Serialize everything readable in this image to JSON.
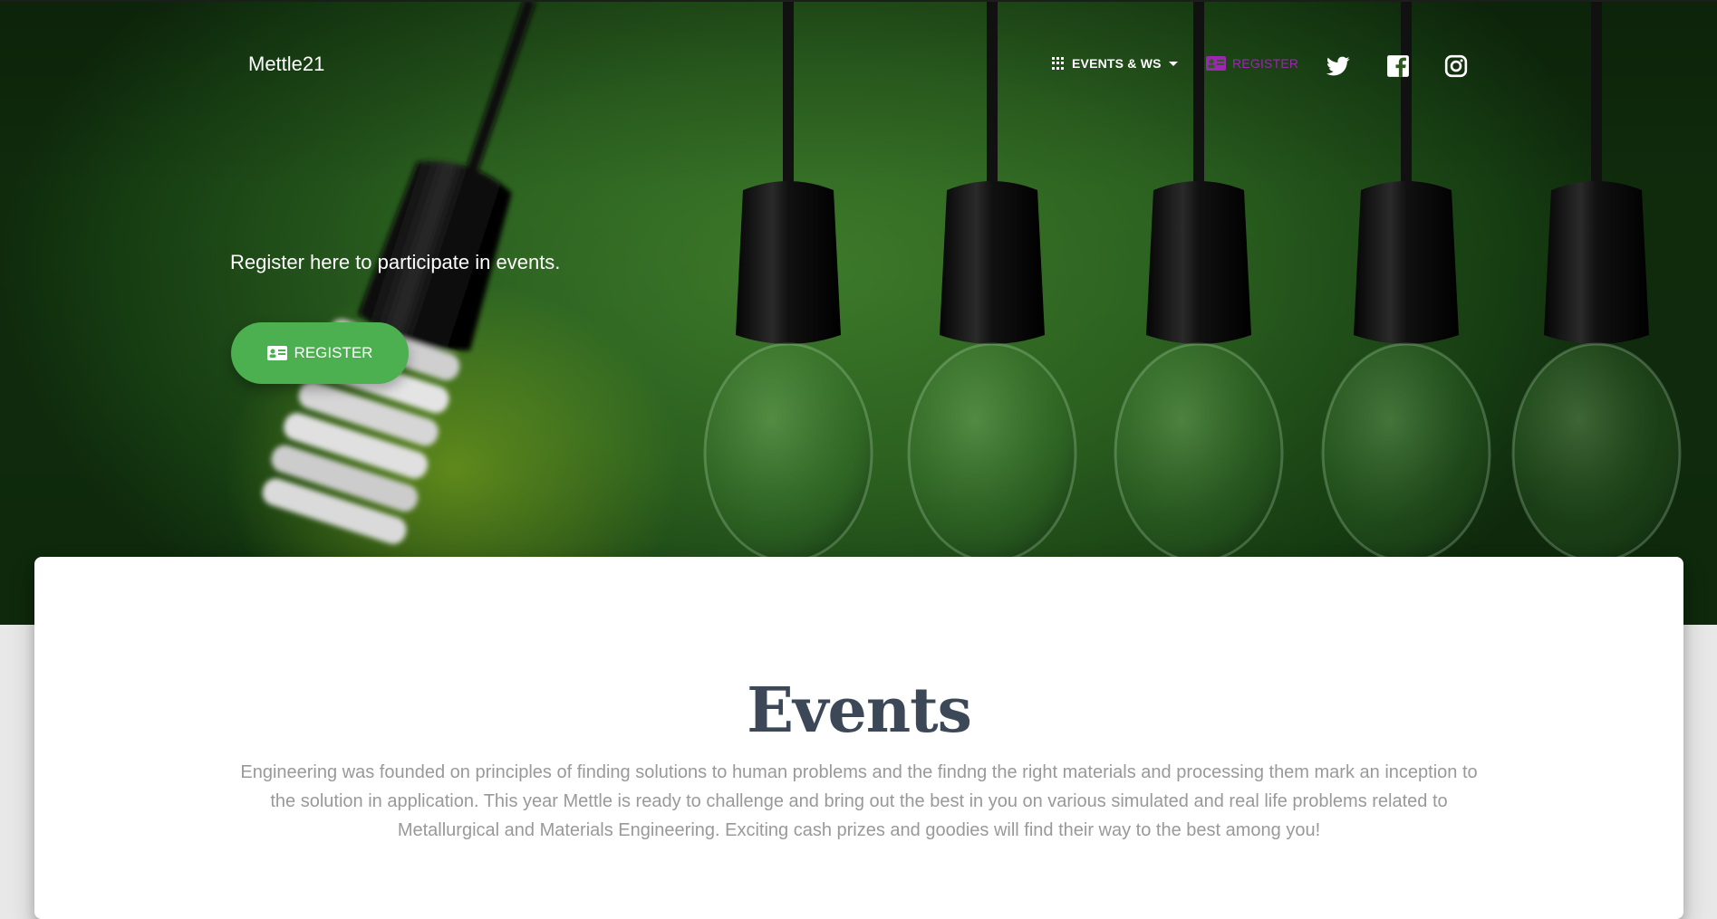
{
  "navbar": {
    "brand": "Mettle21",
    "events_label": "EVENTS & WS",
    "register_label": "REGISTER",
    "social": [
      "twitter-icon",
      "facebook-icon",
      "instagram-icon"
    ]
  },
  "hero": {
    "text": "Register here to participate in events.",
    "button_label": "REGISTER"
  },
  "section": {
    "title": "Events",
    "description": "Engineering was founded on principles of finding solutions to human problems and the findng the right materials and processing them mark an inception to the solution in application. This year Mettle is ready to challenge and bring out the best in you on various simulated and real life problems related to Metallurgical and Materials Engineering. Exciting cash prizes and goodies will find their way to the best among you!"
  },
  "colors": {
    "accent_green": "#4caf50",
    "register_purple": "#9c27b0",
    "title_gray": "#3c4858",
    "desc_gray": "#999999"
  }
}
